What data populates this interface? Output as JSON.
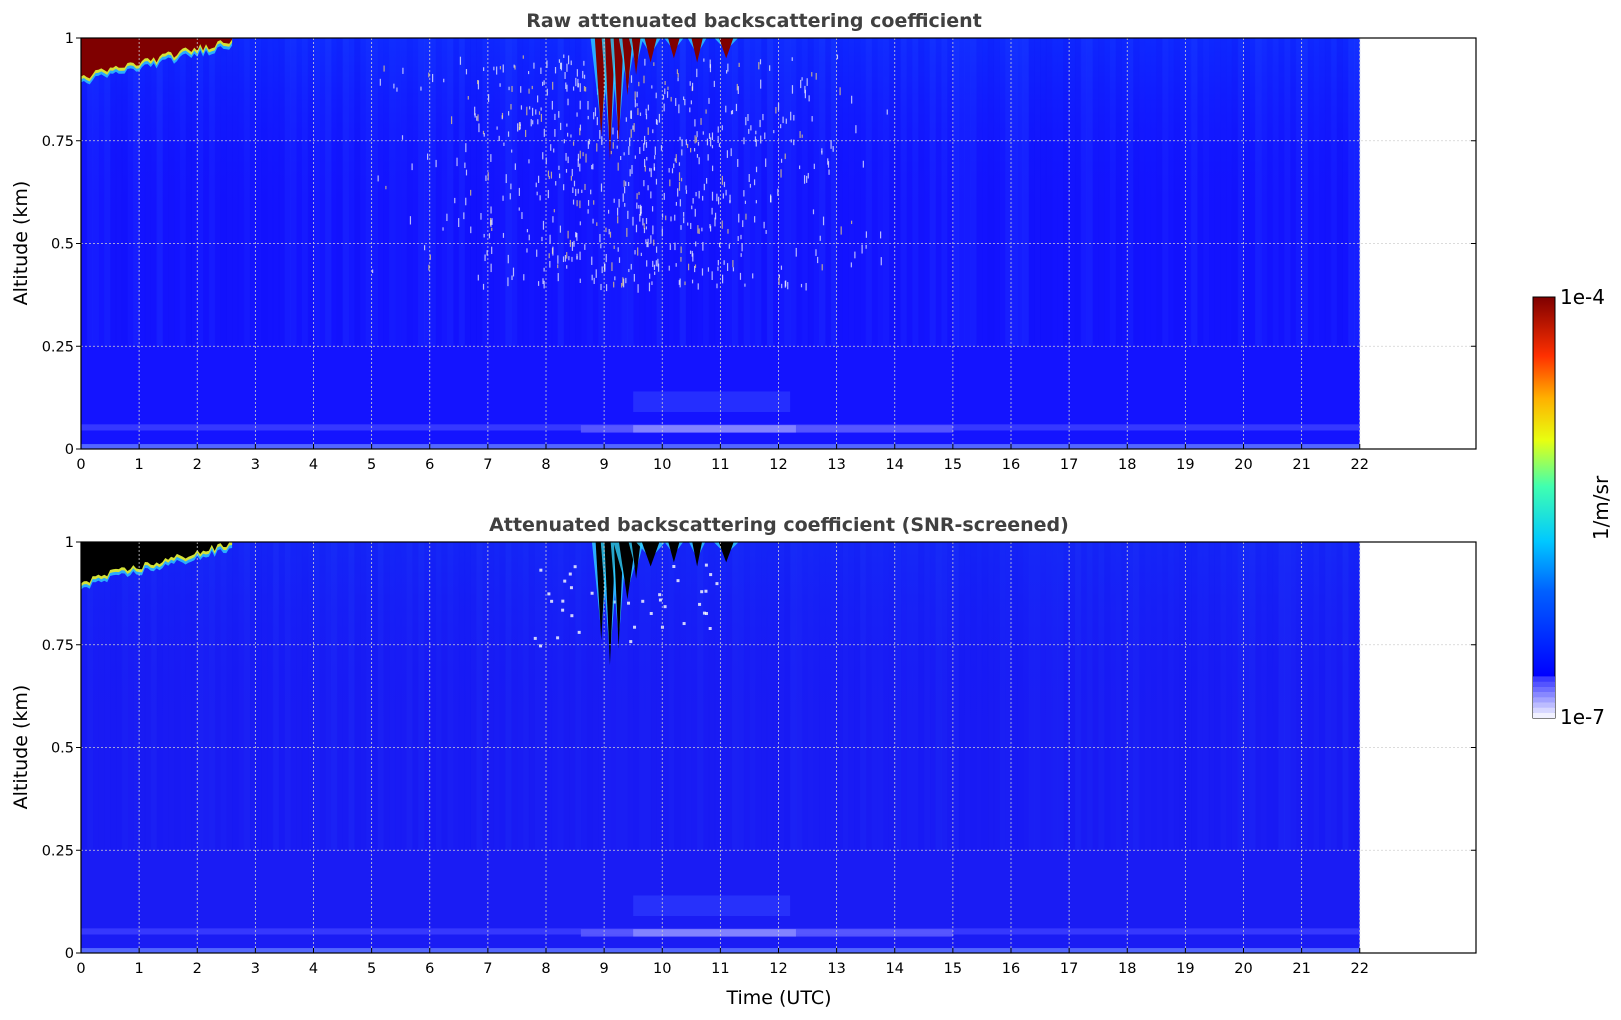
{
  "chart_data": [
    {
      "type": "heatmap",
      "title": "Raw attenuated backscattering coefficient",
      "xlabel": "",
      "ylabel": "Altitude (km)",
      "xlim": [
        0,
        24
      ],
      "ylim": [
        0,
        1
      ],
      "data_extent_x": [
        0,
        22
      ],
      "xticks": [
        0,
        1,
        2,
        3,
        4,
        5,
        6,
        7,
        8,
        9,
        10,
        11,
        12,
        13,
        14,
        15,
        16,
        17,
        18,
        19,
        20,
        21,
        22
      ],
      "yticks": [
        0,
        0.25,
        0.5,
        0.75,
        1
      ],
      "ytick_labels": [
        "0",
        "0.25",
        "0.5",
        "0.75",
        "1"
      ],
      "grid": true,
      "colormap": "jet",
      "scale": "log",
      "screened": false,
      "features": [
        {
          "label": "low cloud top",
          "x": [
            0,
            2.5
          ],
          "y": [
            0.9,
            1.0
          ],
          "level": "high"
        },
        {
          "label": "cloud near 9-11 UTC",
          "x": [
            8.8,
            11.3
          ],
          "y": [
            0.75,
            1.0
          ],
          "level": "high"
        },
        {
          "label": "noise speckle",
          "x": [
            5,
            14
          ],
          "y": [
            0.4,
            0.95
          ],
          "level": "low"
        }
      ]
    },
    {
      "type": "heatmap",
      "title": "Attenuated backscattering coefficient (SNR-screened)",
      "xlabel": "Time (UTC)",
      "ylabel": "Altitude (km)",
      "xlim": [
        0,
        24
      ],
      "ylim": [
        0,
        1
      ],
      "data_extent_x": [
        0,
        22
      ],
      "xticks": [
        0,
        1,
        2,
        3,
        4,
        5,
        6,
        7,
        8,
        9,
        10,
        11,
        12,
        13,
        14,
        15,
        16,
        17,
        18,
        19,
        20,
        21,
        22
      ],
      "yticks": [
        0,
        0.25,
        0.5,
        0.75,
        1
      ],
      "ytick_labels": [
        "0",
        "0.25",
        "0.5",
        "0.75",
        "1"
      ],
      "grid": true,
      "colormap": "jet",
      "scale": "log",
      "screened": true,
      "features": [
        {
          "label": "low cloud top",
          "x": [
            0,
            2.5
          ],
          "y": [
            0.9,
            1.0
          ],
          "level": "saturated"
        },
        {
          "label": "cloud near 9-11 UTC",
          "x": [
            8.8,
            11.3
          ],
          "y": [
            0.72,
            1.0
          ],
          "level": "saturated"
        }
      ]
    }
  ],
  "colorbar": {
    "label": "1/m/sr",
    "min_label": "1e-7",
    "max_label": "1e-4",
    "min": 1e-07,
    "max": 0.0001,
    "scale": "log",
    "colors": {
      "background": "#1414ff",
      "saturated_high": "#7f0000",
      "screened_cloud": "#000000",
      "low_band": "#5a5aff"
    }
  }
}
